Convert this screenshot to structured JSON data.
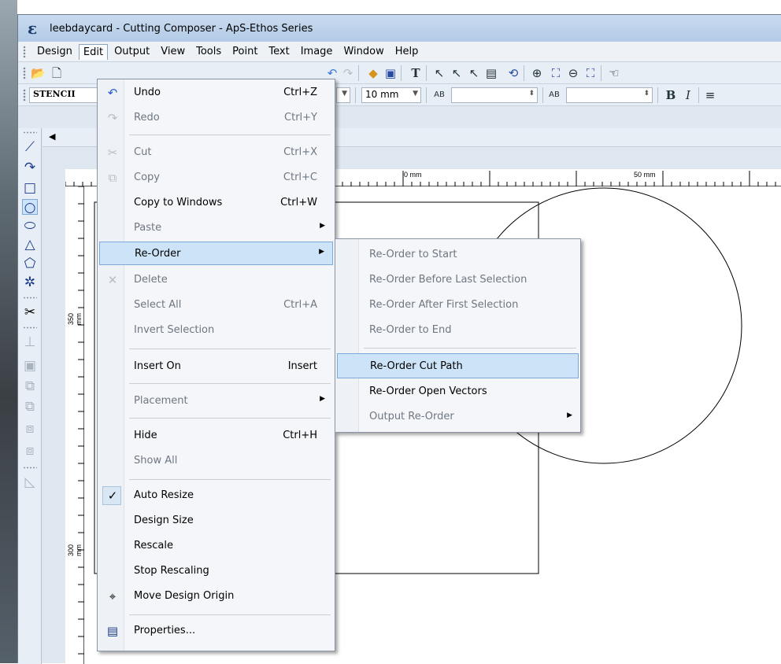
{
  "window": {
    "title": "leebdaycard - Cutting Composer - ApS-Ethos Series",
    "icon_letter": "ε"
  },
  "menubar": {
    "items": [
      "Design",
      "Edit",
      "Output",
      "View",
      "Tools",
      "Point",
      "Text",
      "Image",
      "Window",
      "Help"
    ]
  },
  "toolbar2": {
    "font_combo": "STENCII",
    "size_combo": "10 mm",
    "bold": "B",
    "italic": "I"
  },
  "ruler": {
    "top_labels": [
      "0 mm",
      "50 mm"
    ],
    "left_labels": [
      "350 mm",
      "300 mm"
    ]
  },
  "doc_tab_arrow": "◀",
  "edit_menu": {
    "items": [
      {
        "label": "Undo",
        "shortcut": "Ctrl+Z",
        "enabled": true,
        "icon": "undo-icon"
      },
      {
        "label": "Redo",
        "shortcut": "Ctrl+Y",
        "enabled": false,
        "icon": "redo-icon"
      },
      {
        "label": "Cut",
        "shortcut": "Ctrl+X",
        "enabled": false,
        "icon": "scissors-icon"
      },
      {
        "label": "Copy",
        "shortcut": "Ctrl+C",
        "enabled": false,
        "icon": "copy-icon"
      },
      {
        "label": "Copy to Windows",
        "shortcut": "Ctrl+W",
        "enabled": true
      },
      {
        "label": "Paste",
        "shortcut": "",
        "enabled": false,
        "submenu": true
      },
      {
        "label": "Re-Order",
        "shortcut": "",
        "enabled": true,
        "submenu": true,
        "highlighted": true
      },
      {
        "label": "Delete",
        "shortcut": "",
        "enabled": false,
        "icon": "delete-icon"
      },
      {
        "label": "Select All",
        "shortcut": "Ctrl+A",
        "enabled": false
      },
      {
        "label": "Invert Selection",
        "shortcut": "",
        "enabled": false
      },
      {
        "label": "Insert On",
        "shortcut": "Insert",
        "enabled": true
      },
      {
        "label": "Placement",
        "shortcut": "",
        "enabled": false,
        "submenu": true
      },
      {
        "label": "Hide",
        "shortcut": "Ctrl+H",
        "enabled": true
      },
      {
        "label": "Show All",
        "shortcut": "",
        "enabled": false
      },
      {
        "label": "Auto Resize",
        "shortcut": "",
        "enabled": true,
        "checked": true
      },
      {
        "label": "Design Size",
        "shortcut": "",
        "enabled": true
      },
      {
        "label": "Rescale",
        "shortcut": "",
        "enabled": true
      },
      {
        "label": "Stop Rescaling",
        "shortcut": "",
        "enabled": true
      },
      {
        "label": "Move Design Origin",
        "shortcut": "",
        "enabled": true,
        "icon": "crosshair-icon"
      },
      {
        "label": "Properties...",
        "shortcut": "",
        "enabled": true,
        "icon": "properties-icon"
      }
    ]
  },
  "reorder_submenu": {
    "items": [
      {
        "label": "Re-Order to Start",
        "enabled": false
      },
      {
        "label": "Re-Order Before Last Selection",
        "enabled": false
      },
      {
        "label": "Re-Order After First Selection",
        "enabled": false
      },
      {
        "label": "Re-Order to End",
        "enabled": false
      },
      {
        "label": "Re-Order Cut Path",
        "enabled": true,
        "highlighted": true
      },
      {
        "label": "Re-Order Open Vectors",
        "enabled": true
      },
      {
        "label": "Output Re-Order",
        "enabled": false,
        "submenu": true
      }
    ]
  },
  "colors": {
    "highlight": "#cde4f8",
    "highlight_border": "#7da9d8",
    "disabled_text": "#6f7782"
  }
}
